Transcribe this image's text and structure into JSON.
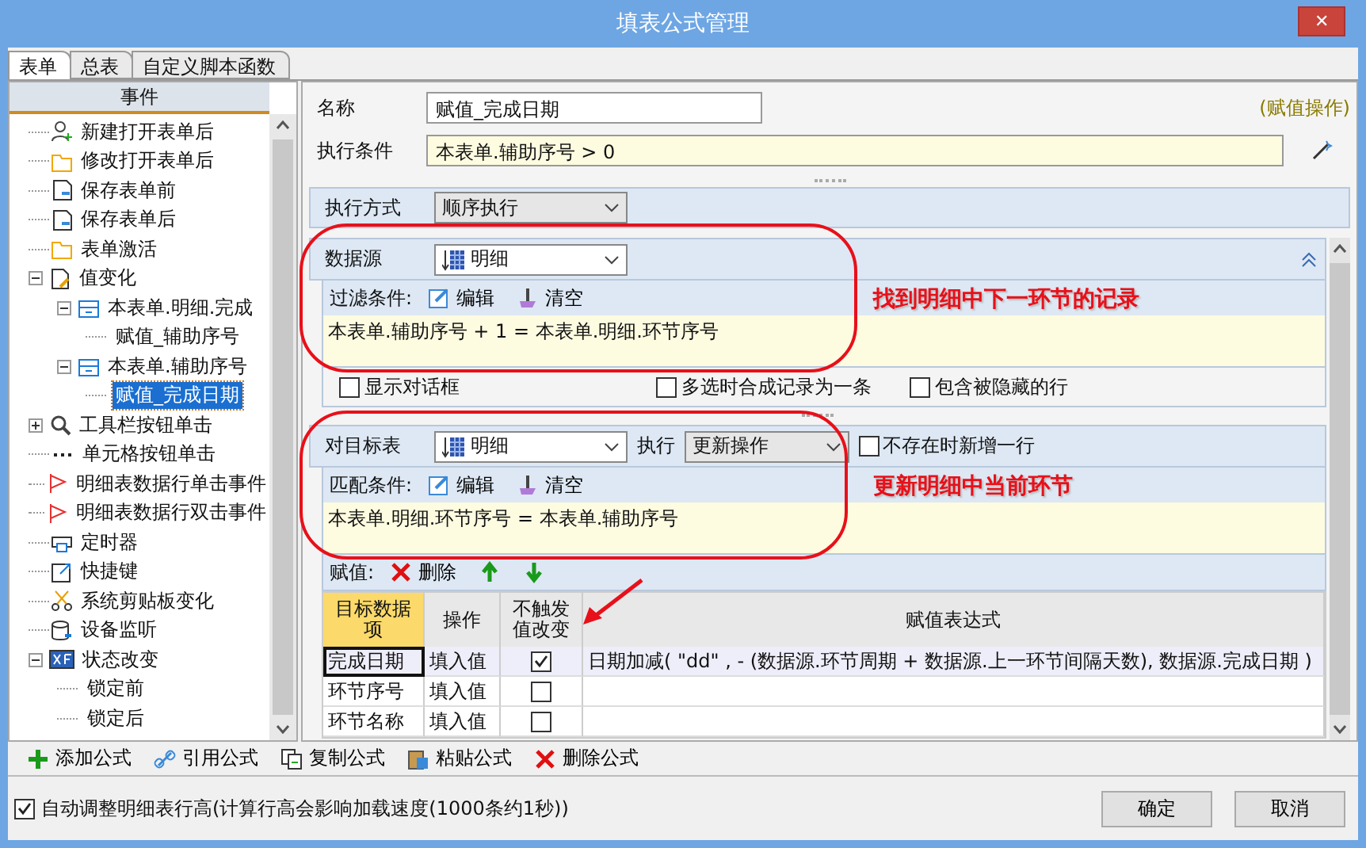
{
  "window": {
    "title": "填表公式管理",
    "close": "✕"
  },
  "tabs": [
    {
      "label": "表单",
      "selected": true
    },
    {
      "label": "总表",
      "selected": false
    },
    {
      "label": "自定义脚本函数",
      "selected": false
    }
  ],
  "sidebar": {
    "header": "事件",
    "tree": [
      {
        "label": "新建打开表单后",
        "kind": "user"
      },
      {
        "label": "修改打开表单后",
        "kind": "folder"
      },
      {
        "label": "保存表单前",
        "kind": "savein"
      },
      {
        "label": "保存表单后",
        "kind": "saveout"
      },
      {
        "label": "表单激活",
        "kind": "folder"
      },
      {
        "label": "值变化",
        "kind": "doc",
        "expanded": true,
        "children": [
          {
            "label": "本表单.明细.完成",
            "kind": "table",
            "expanded": true,
            "children": [
              {
                "label": "赋值_辅助序号",
                "selected": false
              }
            ]
          },
          {
            "label": "本表单.辅助序号",
            "kind": "table",
            "expanded": true,
            "children": [
              {
                "label": "赋值_完成日期",
                "selected": true
              }
            ]
          }
        ]
      },
      {
        "label": "工具栏按钮单击",
        "kind": "search",
        "expanded": false
      },
      {
        "label": "单元格按钮单击",
        "kind": "dots"
      },
      {
        "label": "明细表数据行单击事件",
        "kind": "flag"
      },
      {
        "label": "明细表数据行双击事件",
        "kind": "flag"
      },
      {
        "label": "定时器",
        "kind": "printer"
      },
      {
        "label": "快捷键",
        "kind": "shortcut"
      },
      {
        "label": "系统剪贴板变化",
        "kind": "scissors"
      },
      {
        "label": "设备监听",
        "kind": "database"
      },
      {
        "label": "状态改变",
        "kind": "status",
        "expanded": true,
        "children": [
          {
            "label": "锁定前"
          },
          {
            "label": "锁定后"
          }
        ]
      }
    ]
  },
  "form": {
    "name_label": "名称",
    "name_value": "赋值_完成日期",
    "type_note": "(赋值操作)",
    "condition_label": "执行条件",
    "condition_value": "本表单.辅助序号  > 0"
  },
  "mode": {
    "label": "执行方式",
    "value": "顺序执行"
  },
  "source": {
    "label": "数据源",
    "value": "明细",
    "filter_label": "过滤条件:",
    "edit": "编辑",
    "clear": "清空",
    "expression": "本表单.辅助序号  + 1 =  本表单.明细.环节序号",
    "options": [
      {
        "label": "显示对话框",
        "checked": false
      },
      {
        "label": "多选时合成记录为一条",
        "checked": false
      },
      {
        "label": "包含被隐藏的行",
        "checked": false
      }
    ]
  },
  "target": {
    "label": "对目标表",
    "value": "明细",
    "action_label": "执行",
    "action_value": "更新操作",
    "add_new": {
      "label": "不存在时新增一行",
      "checked": false
    },
    "match_label": "匹配条件:",
    "edit": "编辑",
    "clear": "清空",
    "expression": "本表单.明细.环节序号   =    本表单.辅助序号",
    "assign_label": "赋值:",
    "delete": "删除",
    "table": {
      "columns": [
        "目标数据项",
        "操作",
        "不触发值改变",
        "赋值表达式"
      ],
      "rows": [
        {
          "target": "完成日期",
          "op": "填入值",
          "no_trigger": true,
          "expr": "日期加减( \"dd\" , - (数据源.环节周期 + 数据源.上一环节间隔天数), 数据源.完成日期 )",
          "selected": true
        },
        {
          "target": "环节序号",
          "op": "填入值",
          "no_trigger": false,
          "selected": false
        },
        {
          "target": "环节名称",
          "op": "填入值",
          "no_trigger": false,
          "selected": false
        }
      ]
    }
  },
  "annotations": [
    "找到明细中下一环节的记录",
    "更新明细中当前环节"
  ],
  "toolbar": [
    {
      "label": "添加公式",
      "kind": "add"
    },
    {
      "label": "引用公式",
      "kind": "link"
    },
    {
      "label": "复制公式",
      "kind": "copy"
    },
    {
      "label": "粘贴公式",
      "kind": "paste"
    },
    {
      "label": "删除公式",
      "kind": "delete"
    }
  ],
  "footer": {
    "auto_height": {
      "label": "自动调整明细表行高(计算行高会影响加载速度(1000条约1秒))",
      "checked": true
    },
    "buttons": [
      "确定",
      "取消"
    ]
  }
}
